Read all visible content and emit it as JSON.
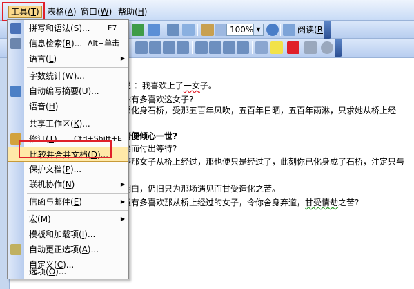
{
  "menubar": {
    "items": [
      {
        "label": "工具(",
        "mnemonic": "T",
        "tail": ")"
      },
      {
        "label": "表格(",
        "mnemonic": "A",
        "tail": ")"
      },
      {
        "label": "窗口(",
        "mnemonic": "W",
        "tail": ")"
      },
      {
        "label": "帮助(",
        "mnemonic": "H",
        "tail": ")"
      }
    ]
  },
  "toolbar": {
    "zoom_value": "100%",
    "zoom_arrow": "▼",
    "read_label": "阅读(",
    "read_mnemonic": "R",
    "read_tail": ")",
    "more_arrow": "▸"
  },
  "menu": {
    "items": [
      {
        "label": "拼写和语法(",
        "mnemonic": "S",
        "tail": ")...",
        "shortcut": "F7",
        "arrow": "",
        "icon": "spelling-icon"
      },
      {
        "label": "信息检索(",
        "mnemonic": "R",
        "tail": ")...",
        "shortcut": "Alt+单击",
        "arrow": "",
        "icon": "research-icon"
      },
      {
        "label": "语言(",
        "mnemonic": "L",
        "tail": ")",
        "shortcut": "",
        "arrow": "▶",
        "icon": ""
      },
      {
        "label": "字数统计(",
        "mnemonic": "W",
        "tail": ")...",
        "shortcut": "",
        "arrow": "",
        "icon": ""
      },
      {
        "label": "自动编写摘要(",
        "mnemonic": "U",
        "tail": ")...",
        "shortcut": "",
        "arrow": "",
        "icon": "autosummarize-icon"
      },
      {
        "label": "语音(",
        "mnemonic": "H",
        "tail": ")",
        "shortcut": "",
        "arrow": "",
        "icon": ""
      },
      {
        "label": "共享工作区(",
        "mnemonic": "K",
        "tail": ")...",
        "shortcut": "",
        "arrow": "",
        "icon": ""
      },
      {
        "label": "修订(",
        "mnemonic": "T",
        "tail": ")",
        "shortcut": "Ctrl+Shift+E",
        "arrow": "",
        "icon": "track-changes-icon"
      },
      {
        "label": "比较并合并文档(",
        "mnemonic": "D",
        "tail": ")...",
        "shortcut": "",
        "arrow": "",
        "icon": ""
      },
      {
        "label": "保护文档(",
        "mnemonic": "P",
        "tail": ")...",
        "shortcut": "",
        "arrow": "",
        "icon": ""
      },
      {
        "label": "联机协作(",
        "mnemonic": "N",
        "tail": ")",
        "shortcut": "",
        "arrow": "▶",
        "icon": ""
      },
      {
        "label": "信函与邮件(",
        "mnemonic": "E",
        "tail": ")",
        "shortcut": "",
        "arrow": "▶",
        "icon": ""
      },
      {
        "label": "宏(",
        "mnemonic": "M",
        "tail": ")",
        "shortcut": "",
        "arrow": "▶",
        "icon": ""
      },
      {
        "label": "模板和加载项(",
        "mnemonic": "I",
        "tail": ")...",
        "shortcut": "",
        "arrow": "",
        "icon": ""
      },
      {
        "label": "自动更正选项(",
        "mnemonic": "A",
        "tail": ")...",
        "shortcut": "",
        "arrow": "",
        "icon": "autocorrect-icon"
      },
      {
        "label": "自定义(",
        "mnemonic": "C",
        "tail": ")...",
        "shortcut": "",
        "arrow": "",
        "icon": ""
      },
      {
        "label": "选项(",
        "mnemonic": "O",
        "tail": ")...",
        "shortcut": "",
        "arrow": "",
        "icon": ""
      }
    ]
  },
  "document": {
    "lines": [
      {
        "pre": "说 ：我喜欢上了",
        "sq": "一女",
        "post": "子。"
      },
      {
        "pre": "    你有多喜欢这女子?",
        "sq": "",
        "post": ""
      },
      {
        "pre": "愿化身石桥，受那五百年风吹，五百年日晒，五百年雨淋，只求她从桥上经",
        "sq": "",
        "post": ""
      },
      {
        "pre": "情便倾心一世?",
        "sq": "",
        "post": ""
      },
      {
        "pre": "屡而付出等待?",
        "sq": "",
        "post": ""
      },
      {
        "pre": "等那女子从桥上经过，那也便只是经过了，此刻你已化身成了石桥，注定只与",
        "sq": "",
        "post": ""
      },
      {
        "pre": "明白，仍旧只为那场遇见而甘受造化之苦。",
        "sq": "",
        "post": ""
      },
      {
        "pre": "竟有多喜欢那从桥上经过的女子，令你舍身弃道，",
        "sq": "甘受情劫",
        "post": "之苦?"
      }
    ]
  }
}
